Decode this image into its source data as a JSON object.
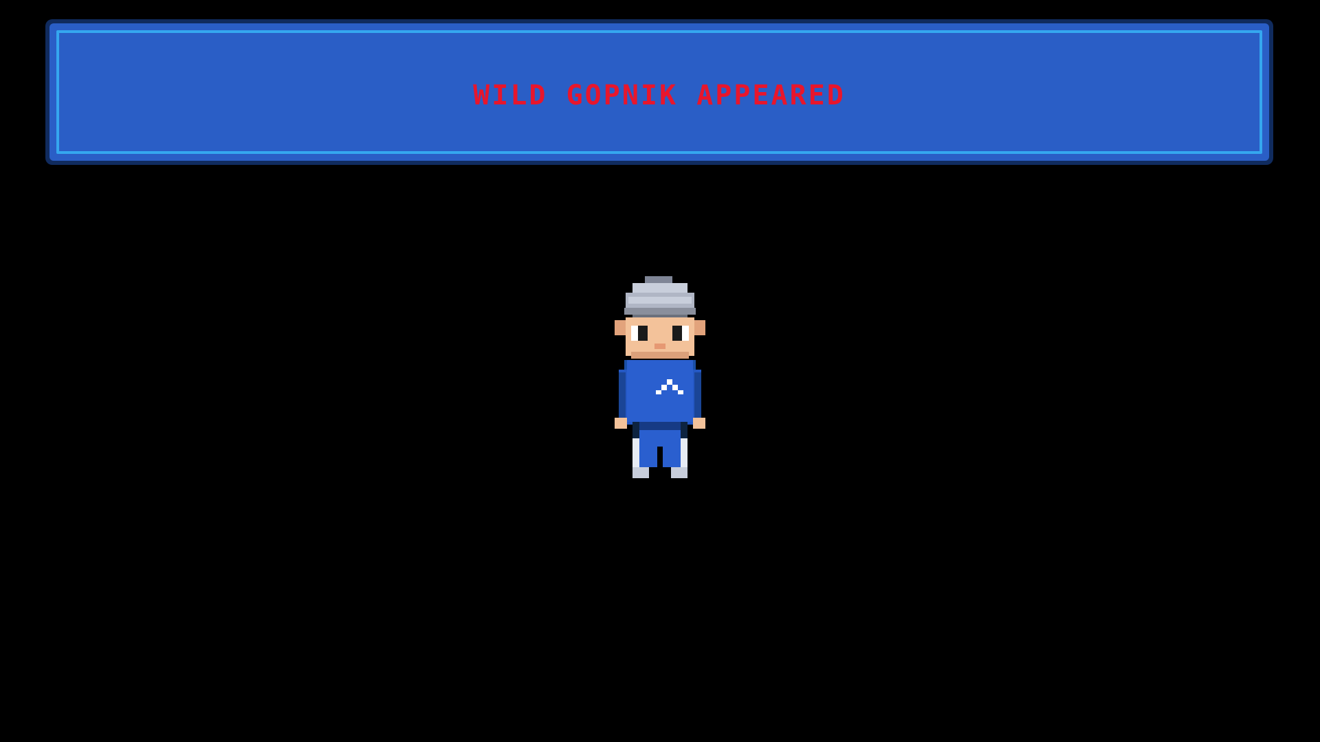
{
  "dialog": {
    "message": "WILD GOPNIK APPEARED",
    "text_color": "#e8162c",
    "box_color": "#2a5ec6",
    "border_color": "#35a7ef"
  },
  "enemy": {
    "name": "gopnik",
    "icon": "gopnik-sprite"
  },
  "background_color": "#000000"
}
